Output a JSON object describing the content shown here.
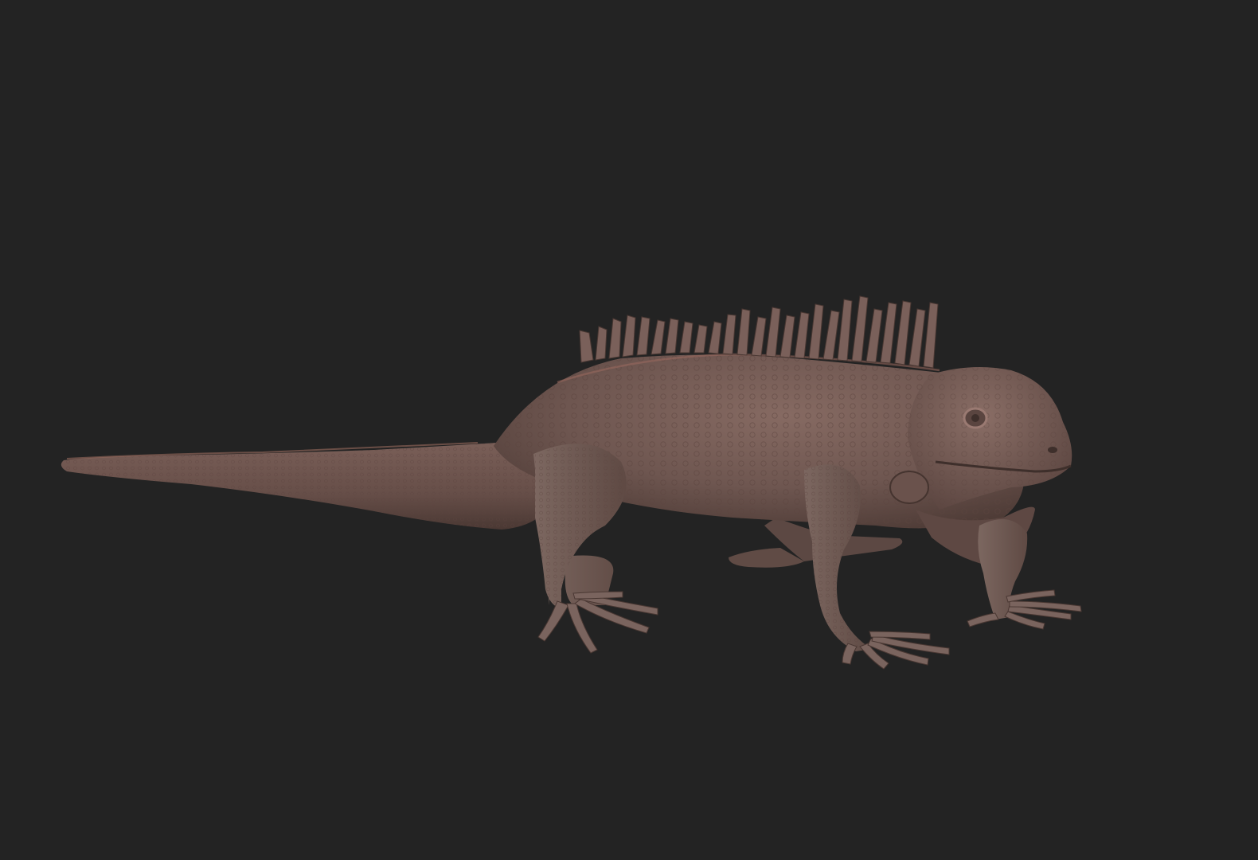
{
  "scene": {
    "subject_icon": "iguana-sculpt",
    "colors": {
      "background": "#232323",
      "skin_base": "#6e5650",
      "skin_light": "#8a6c64",
      "skin_shadow": "#3f302c",
      "rim_light": "#9a6a5e"
    }
  }
}
